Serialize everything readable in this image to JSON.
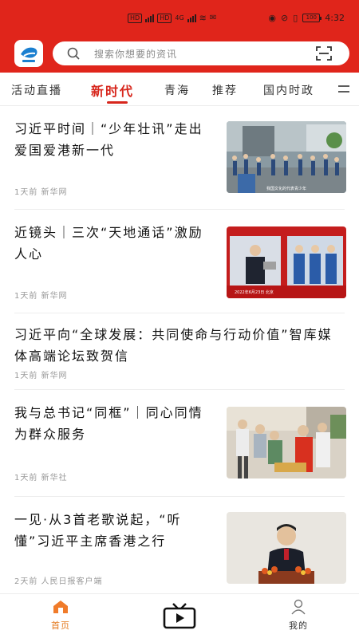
{
  "status_bar": {
    "sim1": "HD",
    "sim2": "HD",
    "network": "4G",
    "battery": "100",
    "time": "4:32"
  },
  "search": {
    "placeholder": "搜索你想要的资讯"
  },
  "tabs": [
    {
      "label": "活动直播",
      "active": false
    },
    {
      "label": "新时代",
      "active": true
    },
    {
      "label": "青海",
      "active": false
    },
    {
      "label": "推荐",
      "active": false
    },
    {
      "label": "国内时政",
      "active": false
    }
  ],
  "news": [
    {
      "title": "习近平时间｜“少年壮讯”走出爱国爱港新一代",
      "meta": "1天前  新华网",
      "image": "students-photo",
      "image_caption": "我国文化的代表青少年"
    },
    {
      "title": "近镜头｜三次“天地通话”激励人心",
      "meta": "1天前  新华网",
      "image": "astronaut-photo",
      "image_caption": "2022年6月23日  北京"
    },
    {
      "title": "习近平向“全球发展：共同使命与行动价值”智库媒体高端论坛致贺信",
      "meta": "1天前  新华网",
      "image": null
    },
    {
      "title": "我与总书记“同框”｜同心同情为群众服务",
      "meta": "1天前  新华社",
      "image": "volunteers-photo"
    },
    {
      "title": "一见·从3首老歌说起，“听懂”习近平主席香港之行",
      "meta": "2天前  人民日报客户端",
      "image": "speech-photo"
    }
  ],
  "bottom_nav": [
    {
      "label": "首页",
      "icon": "home-icon",
      "active": true
    },
    {
      "label": "",
      "icon": "tv-icon",
      "active": false
    },
    {
      "label": "我的",
      "icon": "user-icon",
      "active": false
    }
  ],
  "colors": {
    "brand_red": "#e0251b",
    "active_tab": "#d7261c",
    "nav_active": "#e47a1f"
  }
}
